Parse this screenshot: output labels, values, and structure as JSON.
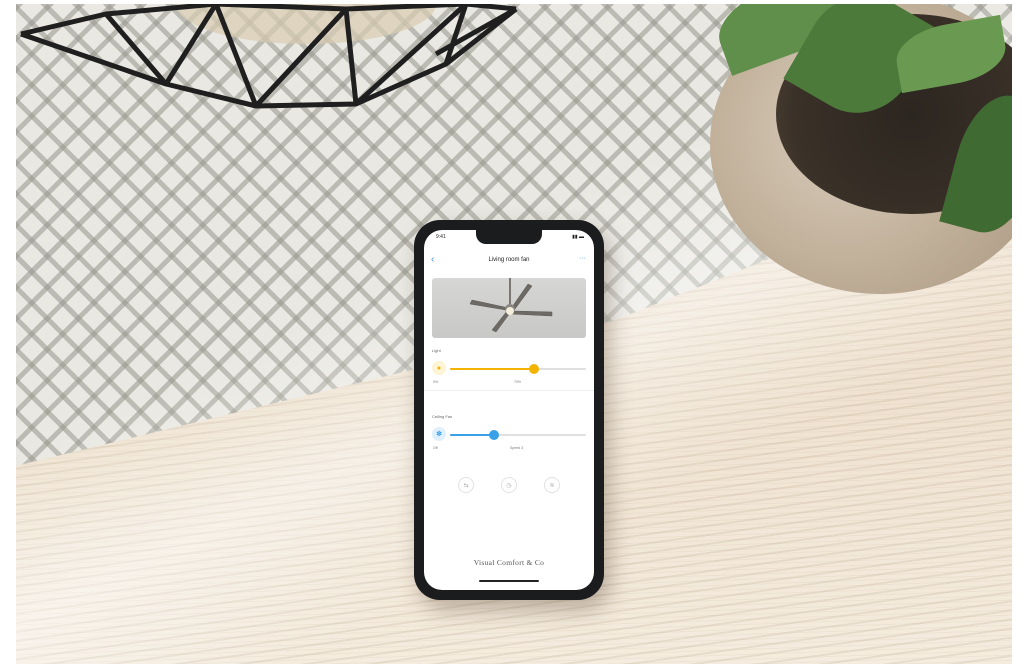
{
  "colors": {
    "light_accent": "#f2b400",
    "fan_accent": "#3aa0e8",
    "nav_accent": "#3a8ee0"
  },
  "phone": {
    "status_time": "9:41",
    "status_icons": "▮▮ ▬",
    "nav_back": "‹",
    "title": "Living room fan",
    "nav_more": "···",
    "light": {
      "section_label": "Light",
      "icon": "lightbulb-icon",
      "min_label": "0%",
      "max_label": "70%",
      "level": 0.62
    },
    "fan": {
      "section_label": "Ceiling Fan",
      "icon": "fan-icon",
      "min_label": "Off",
      "max_label": "Speed 3",
      "level": 0.32
    },
    "mode_buttons": [
      {
        "icon": "reverse-icon",
        "glyph": "⇆"
      },
      {
        "icon": "timer-icon",
        "glyph": "◷"
      },
      {
        "icon": "breeze-icon",
        "glyph": "≋"
      }
    ],
    "brand": "Visual Comfort & Co"
  }
}
